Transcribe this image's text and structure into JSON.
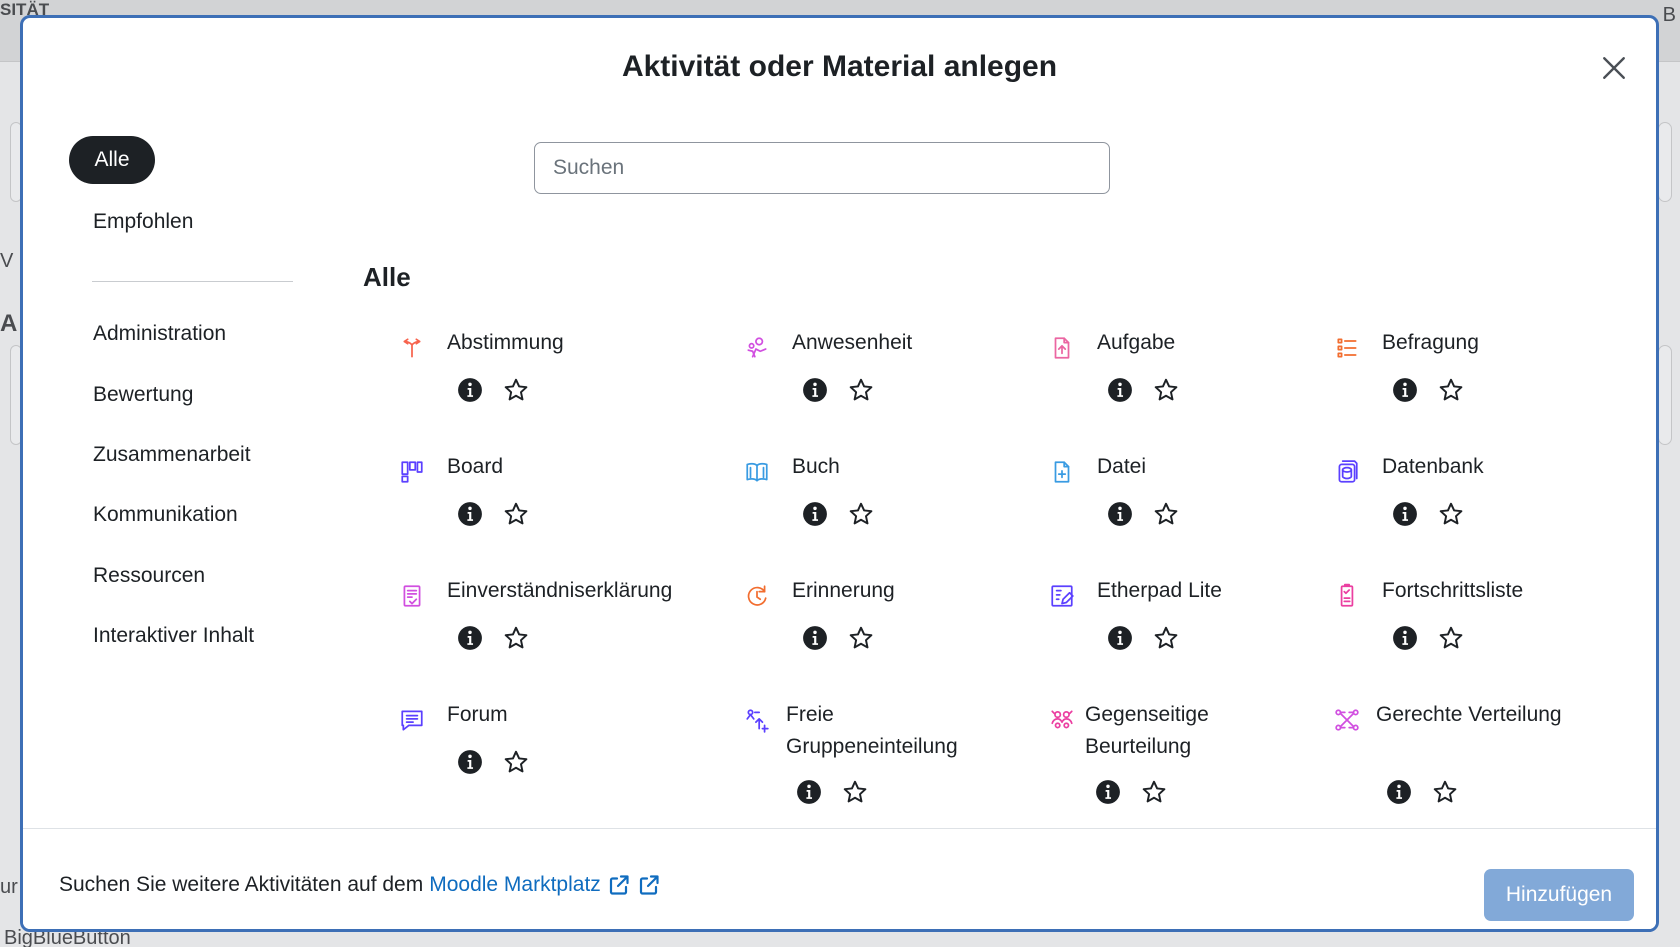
{
  "background": {
    "brand_fragment": "SITÄT",
    "right_fragment": "B",
    "left_fragment_1": "V",
    "left_fragment_2": "A",
    "bottom_left_fragment": "ur",
    "bottom_text": "BigBlueButton"
  },
  "modal": {
    "title": "Aktivität oder Material anlegen",
    "close_icon": "close-icon"
  },
  "nav": {
    "active": "Alle",
    "recommended": "Empfohlen",
    "categories": [
      "Administration",
      "Bewertung",
      "Zusammenarbeit",
      "Kommunikation",
      "Ressourcen",
      "Interaktiver Inhalt"
    ]
  },
  "search": {
    "placeholder": "Suchen"
  },
  "section": {
    "heading": "Alle"
  },
  "activities": [
    {
      "name": "Abstimmung",
      "icon": "choice-icon",
      "color": "#f7634d"
    },
    {
      "name": "Anwesenheit",
      "icon": "attendance-icon",
      "color": "#d14fe0"
    },
    {
      "name": "Aufgabe",
      "icon": "assignment-icon",
      "color": "#eb66a2"
    },
    {
      "name": "Befragung",
      "icon": "survey-icon",
      "color": "#f26d2f"
    },
    {
      "name": "Board",
      "icon": "board-icon",
      "color": "#5b40ff"
    },
    {
      "name": "Buch",
      "icon": "book-icon",
      "color": "#399be2"
    },
    {
      "name": "Datei",
      "icon": "file-icon",
      "color": "#399be2"
    },
    {
      "name": "Datenbank",
      "icon": "database-icon",
      "color": "#5b40ff"
    },
    {
      "name": "Einverständniserklärung",
      "icon": "consent-icon",
      "color": "#d14fe0"
    },
    {
      "name": "Erinnerung",
      "icon": "reminder-icon",
      "color": "#f26d2f"
    },
    {
      "name": "Etherpad Lite",
      "icon": "etherpad-icon",
      "color": "#5b40ff"
    },
    {
      "name": "Fortschrittsliste",
      "icon": "checklist-icon",
      "color": "#eb3fa1"
    },
    {
      "name": "Forum",
      "icon": "forum-icon",
      "color": "#5b40ff"
    },
    {
      "name": "Freie Gruppeneinteilung",
      "icon": "group-choice-icon",
      "color": "#5b40ff"
    },
    {
      "name": "Gegenseitige Beurteilung",
      "icon": "workshop-icon",
      "color": "#eb3fa1"
    },
    {
      "name": "Gerechte Verteilung",
      "icon": "ratingallocate-icon",
      "color": "#d14fe0"
    }
  ],
  "info_icon": "info-icon",
  "star_icon": "star-icon",
  "footer": {
    "text": "Suchen Sie weitere Aktivitäten auf dem",
    "link": "Moodle Marktplatz",
    "link_color": "#0f6cbf",
    "external_icon": "external-link-icon",
    "add_button": "Hinzufügen"
  },
  "colors": {
    "modal_border": "#3d6fb6",
    "active_pill": "#1d2125",
    "add_button_bg": "#82a9d8"
  }
}
